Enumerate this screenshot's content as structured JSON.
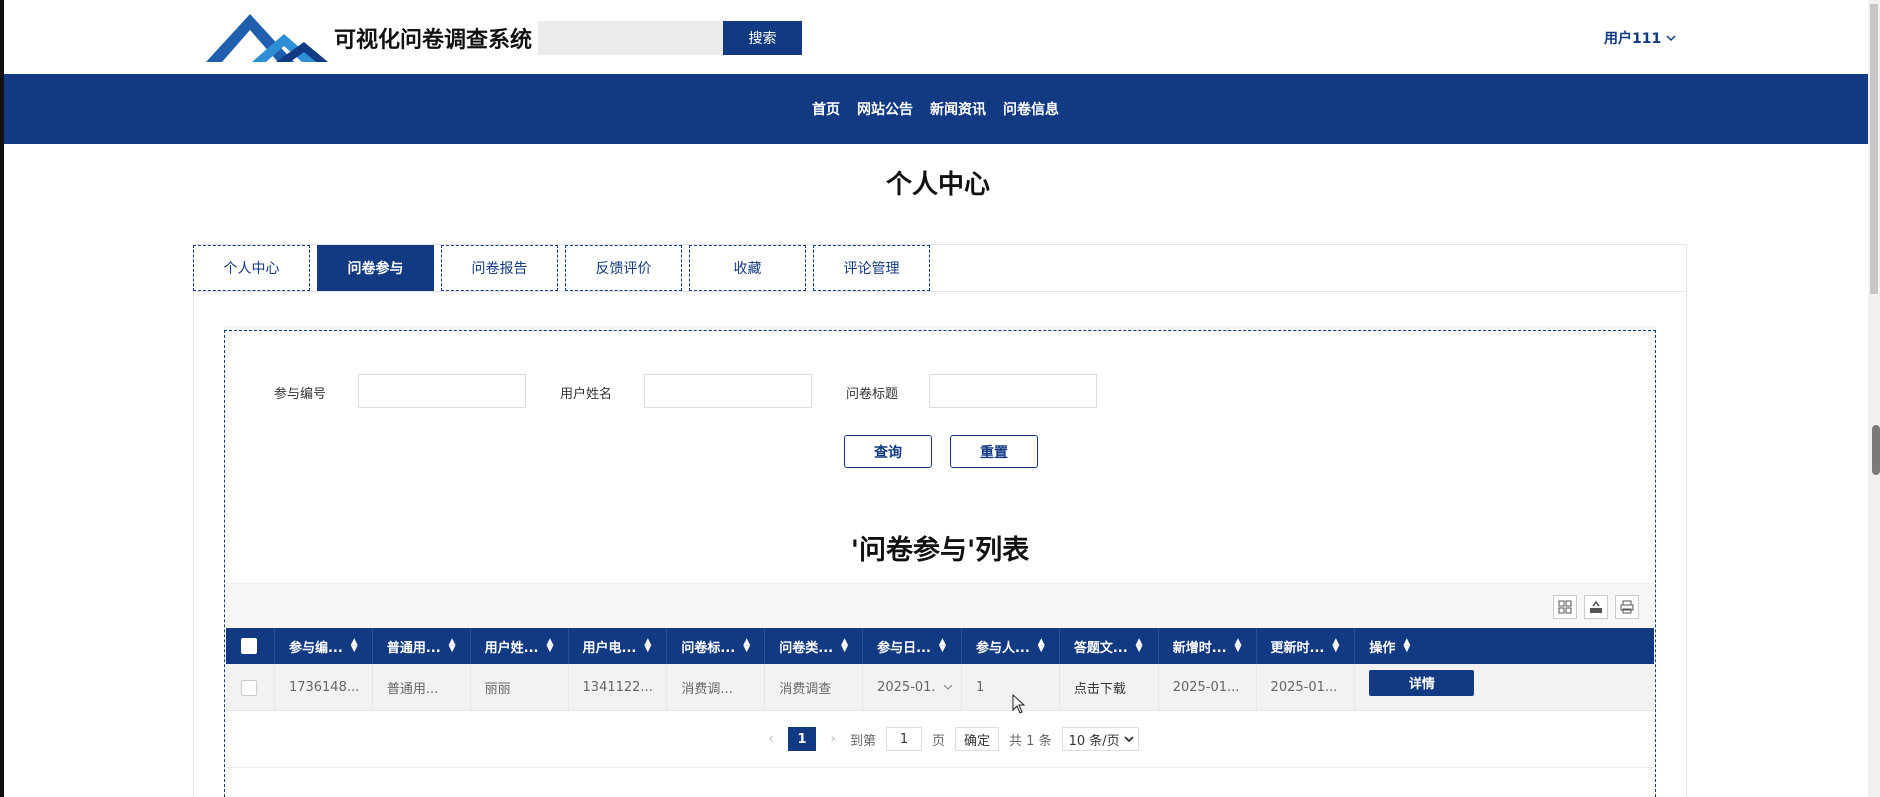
{
  "header": {
    "site_title": "可视化问卷调查系统",
    "search_button": "搜索",
    "search_placeholder": "",
    "user_label": "用户111"
  },
  "nav": {
    "items": [
      "首页",
      "网站公告",
      "新闻资讯",
      "问卷信息"
    ]
  },
  "page_title": "个人中心",
  "tabs": [
    {
      "label": "个人中心",
      "active": false
    },
    {
      "label": "问卷参与",
      "active": true
    },
    {
      "label": "问卷报告",
      "active": false
    },
    {
      "label": "反馈评价",
      "active": false
    },
    {
      "label": "收藏",
      "active": false
    },
    {
      "label": "评论管理",
      "active": false
    }
  ],
  "filters": {
    "participation_no_label": "参与编号",
    "user_name_label": "用户姓名",
    "survey_title_label": "问卷标题",
    "query_button": "查询",
    "reset_button": "重置"
  },
  "list_title": "'问卷参与'列表",
  "toolbar_icons": [
    "grid-icon",
    "export-icon",
    "print-icon"
  ],
  "table": {
    "columns": [
      "参与编...",
      "普通用...",
      "用户姓...",
      "用户电...",
      "问卷标...",
      "问卷类...",
      "参与日...",
      "参与人...",
      "答题文...",
      "新增时...",
      "更新时...",
      "操作"
    ],
    "rows": [
      [
        "1736148...",
        "普通用...",
        "丽丽",
        "1341122...",
        "消费调...",
        "消费调查",
        "2025-01...",
        "1",
        "点击下载",
        "2025-01...",
        "2025-01..."
      ]
    ],
    "detail_button": "详情"
  },
  "pagination": {
    "prev": "‹",
    "current_page": "1",
    "next": "›",
    "goto_label": "到第",
    "goto_value": "1",
    "page_unit": "页",
    "confirm": "确定",
    "total": "共 1 条",
    "page_size": "10 条/页"
  },
  "colors": {
    "primary": "#123a82",
    "background": "#ffffff"
  }
}
